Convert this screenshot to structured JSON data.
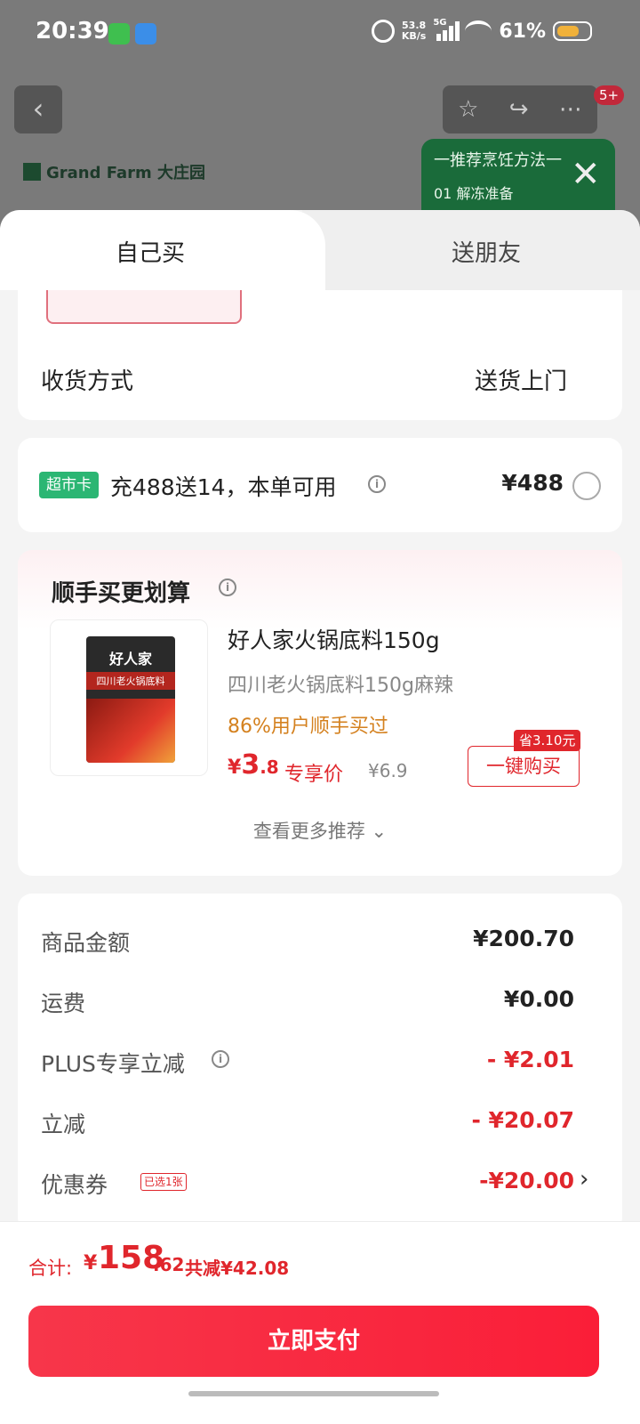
{
  "status_bar": {
    "time": "20:39",
    "net_speed_value": "53.8",
    "net_speed_unit": "KB/s",
    "network": "5G",
    "battery": "61%"
  },
  "background_page": {
    "cart_badge": "5+",
    "brand": "Grand Farm 大庄园",
    "promo_title": "一推荐烹饪方法一",
    "promo_step": "01",
    "promo_step_label": "解冻准备"
  },
  "tabs": [
    {
      "label": "自己买",
      "active": true
    },
    {
      "label": "送朋友",
      "active": false
    }
  ],
  "delivery": {
    "label": "收货方式",
    "value": "送货上门"
  },
  "card_promo": {
    "badge": "超市卡",
    "text": "充488送14，本单可用",
    "price": "¥488"
  },
  "addon": {
    "title": "顺手买更划算",
    "product": {
      "name": "好人家火锅底料150g",
      "subtitle": "四川老火锅底料150g麻辣",
      "social_proof": "86%用户顺手买过",
      "price_currency": "¥",
      "price_integer": "3",
      "price_decimal": ".8",
      "price_tag": "专享价",
      "original_price": "¥6.9",
      "buy_label": "一键购买",
      "save_badge": "省3.10元",
      "pack_brand": "好人家",
      "pack_name": "四川老火锅底料"
    },
    "more_label": "查看更多推荐"
  },
  "summary": {
    "rows": [
      {
        "label": "商品金额",
        "value": "¥200.70",
        "red": false
      },
      {
        "label": "运费",
        "value": "¥0.00",
        "red": false
      },
      {
        "label": "PLUS专享立减",
        "value": "- ¥2.01",
        "red": true
      },
      {
        "label": "立减",
        "value": "- ¥20.07",
        "red": true
      },
      {
        "label": "优惠券",
        "value": "-¥20.00",
        "red": true
      }
    ],
    "coupon_tag": "已选1张"
  },
  "footer": {
    "total_label": "合计:",
    "total_currency": "¥",
    "total_integer": "158",
    "total_decimal": ".62",
    "total_saved": "共减¥42.08",
    "pay_button": "立即支付"
  },
  "colors": {
    "accent": "#e0262c",
    "pay_button": "#fa1e38",
    "badge_green": "#2bb673",
    "social_orange": "#d4811f"
  }
}
